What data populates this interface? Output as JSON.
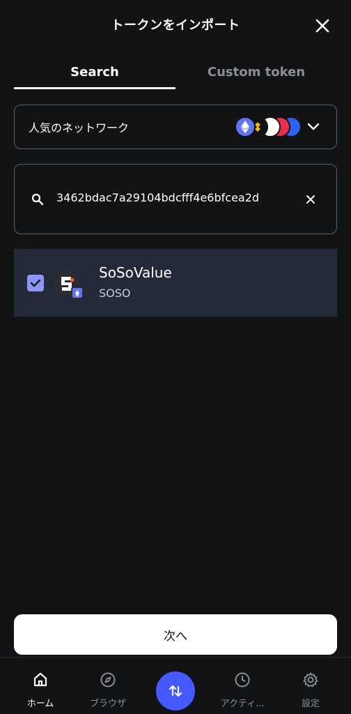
{
  "header": {
    "title": "トークンをインポート",
    "close_icon": "close-icon"
  },
  "tabs": [
    {
      "label": "Search",
      "active": true
    },
    {
      "label": "Custom token",
      "active": false
    }
  ],
  "network_select": {
    "label": "人気のネットワーク",
    "icons": [
      "ethereum-icon",
      "binance-icon",
      "base-icon",
      "optimism-icon",
      "polygon-icon"
    ],
    "chevron": "chevron-down-icon"
  },
  "search": {
    "value": "3462bdac7a29104bdcfff4e6bfcea2d",
    "search_icon": "search-icon",
    "clear_icon": "clear-icon"
  },
  "token": {
    "name": "SoSoValue",
    "symbol": "SOSO",
    "checked": true
  },
  "next_button": {
    "label": "次へ"
  },
  "bottom_nav": [
    {
      "label": "ホーム",
      "icon": "home-icon",
      "active": true
    },
    {
      "label": "ブラウザ",
      "icon": "compass-icon",
      "active": false
    },
    {
      "label": "",
      "icon": "swap-icon",
      "active": false
    },
    {
      "label": "アクティ...",
      "icon": "clock-icon",
      "active": false
    },
    {
      "label": "設定",
      "icon": "gear-icon",
      "active": false
    }
  ],
  "colors": {
    "background": "#121314",
    "accent": "#4459ff",
    "row_highlight": "#252a3a",
    "checkbox": "#8f97f6",
    "border": "#5b5f66",
    "muted_text": "#8a8f98"
  }
}
